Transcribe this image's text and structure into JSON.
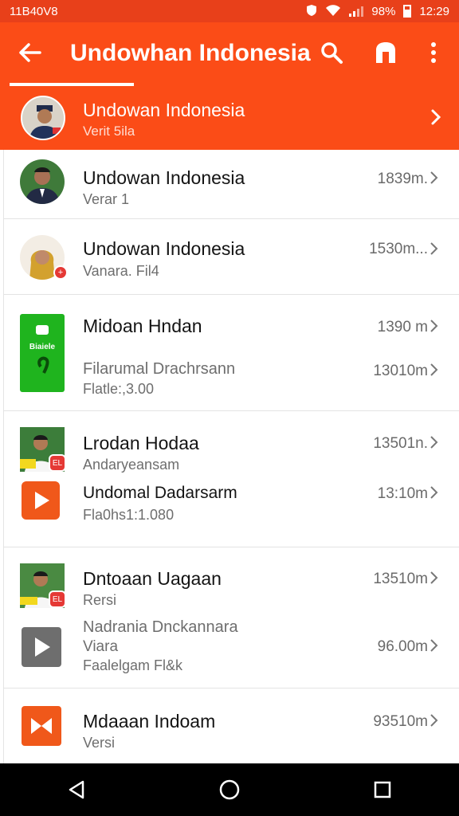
{
  "status_bar": {
    "left_text": "11B40V8",
    "battery": "98%",
    "time": "12:29"
  },
  "app_bar": {
    "title": "Undowhan Indonesia",
    "icons": [
      "back-arrow-icon",
      "search-icon",
      "store-icon",
      "more-vert-icon"
    ]
  },
  "featured": {
    "title": "Undowan Indonesia",
    "subtitle": "Verit 5ila"
  },
  "list": [
    {
      "primary": "Undowan Indonesia",
      "secondary": "Verar 1",
      "meta": "1839m."
    },
    {
      "primary": "Undowan Indonesia",
      "secondary": "Vanara. Fil4",
      "meta": "1530m..."
    },
    {
      "primary": "Midoan Hndan",
      "meta": "1390 m",
      "app_label": "Biaiele"
    },
    {
      "primary": "Filarumal Drachrsann",
      "secondary": "Flatle:,3.00",
      "meta": "13010m"
    },
    {
      "primary": "Lrodan Hodaa",
      "secondary": "Andaryeansam",
      "meta": "13501n.",
      "badge": "EL"
    },
    {
      "primary": "Undomal Dadarsarm",
      "secondary": "Fla0hs1:1.080",
      "meta": "13:10m"
    },
    {
      "primary": "Dntoaan Uagaan",
      "secondary": "Rersi",
      "meta": "13510m",
      "badge": "EL"
    },
    {
      "primary": "Nadrania Dnckannara",
      "secondary": "Viara",
      "tertiary": "Faalelgam Fl&k",
      "meta": "96.00m"
    },
    {
      "primary": "Mdaaan Indoam",
      "secondary": "Versi",
      "meta": "93510m"
    }
  ],
  "colors": {
    "status_bar": "#e8401a",
    "app_bar": "#fb4c17",
    "green_app": "#1fb41e",
    "orange_app": "#f0581a",
    "gray_app": "#6e6e6e"
  }
}
